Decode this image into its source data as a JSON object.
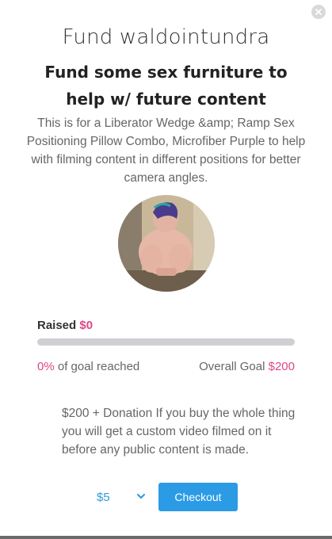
{
  "header": {
    "title": "Fund waldointundra",
    "subtitle": "Fund some sex furniture to help w/ future content",
    "description": "This is for a Liberator Wedge &amp; Ramp Sex Positioning Pillow Combo, Microfiber Purple to help with filming content in different positions for better camera angles."
  },
  "progress": {
    "raised_label": "Raised",
    "raised_amount": "$0",
    "percent_label": "0%",
    "goal_reached_text": " of goal reached",
    "overall_goal_label": "Overall Goal ",
    "goal_amount": "$200",
    "fraction": 0
  },
  "reward": {
    "text": "$200 + Donation If you buy the whole thing you will get a custom video filmed on it before any public content is made."
  },
  "checkout": {
    "amount_selected": "$5",
    "button_label": "Checkout"
  },
  "colors": {
    "accent_pink": "#e0458a",
    "accent_blue": "#2b9be6",
    "bar_track": "#cfcfd4"
  },
  "icons": {
    "close": "close-icon",
    "dropdown": "chevron-down-icon"
  }
}
